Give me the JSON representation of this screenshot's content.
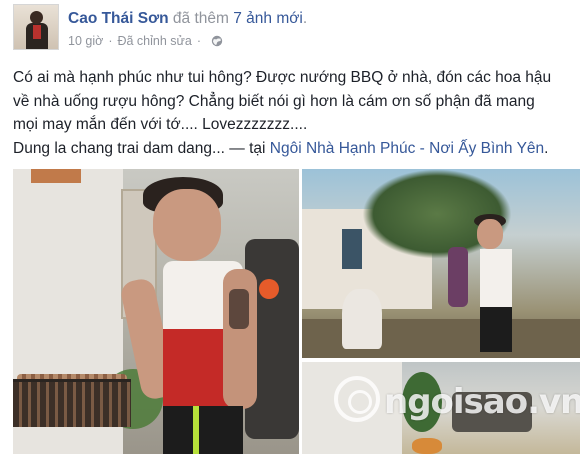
{
  "post": {
    "author": "Cao Thái Sơn",
    "action_text": "đã thêm",
    "photo_count_text": "7 ảnh mới",
    "headline_end": ".",
    "time": "10 giờ",
    "separator": "·",
    "edited": "Đã chỉnh sửa",
    "privacy_icon": "globe-icon",
    "text_lines": [
      "Có ai mà hạnh phúc như tui hông? Được nướng BBQ ở nhà, đón các hoa hậu",
      "về nhà uống rượu hông? Chẳng biết nói gì hơn là cám ơn số phận đã mang",
      "mọi may mắn đến với tớ.... Lovezzzzzzz...."
    ],
    "tag_line_prefix": "Dung la chang trai dam dang... — tại ",
    "tag_place": "Ngôi Nhà Hạnh Phúc - Nơi Ấy Bình Yên",
    "tag_line_suffix": ".",
    "photos": [
      "bbq-grilling-photo",
      "garden-photo",
      "grill-photo"
    ],
    "watermark": "ngoisao.vn",
    "colors": {
      "link": "#365899",
      "muted": "#90949c",
      "text": "#1d2129"
    }
  }
}
